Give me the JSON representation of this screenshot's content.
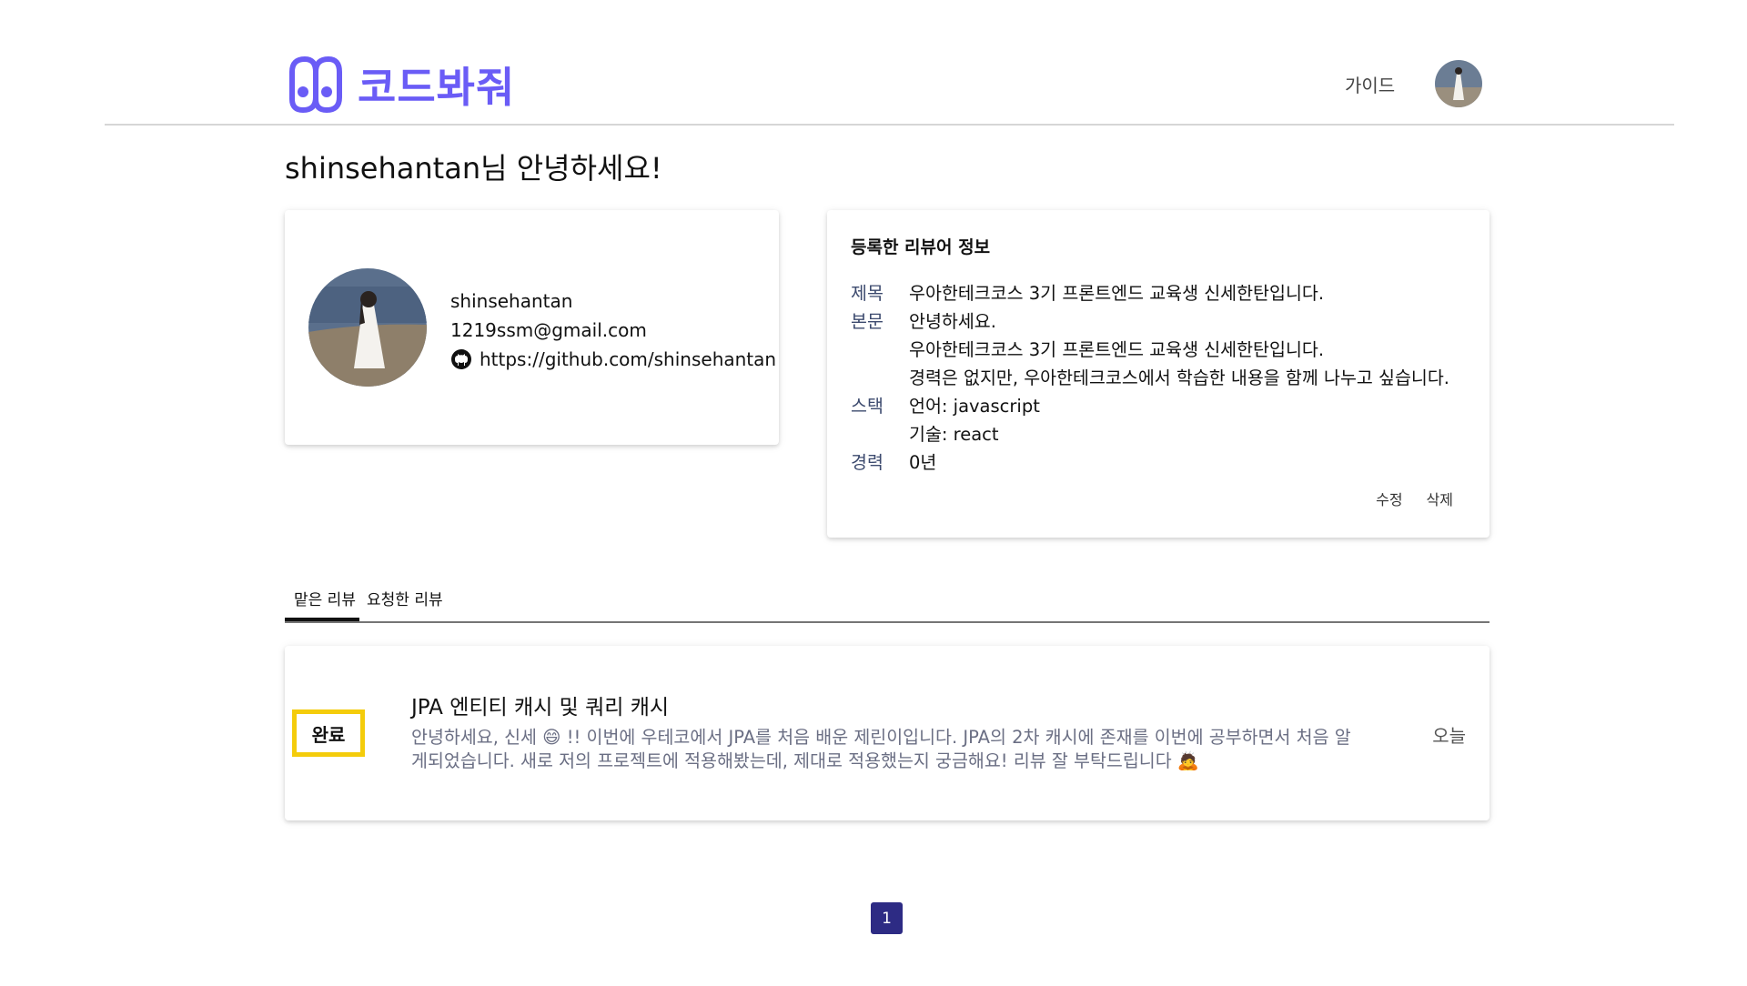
{
  "header": {
    "logo_text": "코드봐줘",
    "nav_guide": "가이드"
  },
  "greeting": "shinsehantan님 안녕하세요!",
  "profile": {
    "username": "shinsehantan",
    "email": "1219ssm@gmail.com",
    "github": "https://github.com/shinsehantan"
  },
  "reviewer": {
    "heading": "등록한 리뷰어 정보",
    "title_label": "제목",
    "title_value": "우아한테크코스 3기 프론트엔드 교육생 신세한탄입니다.",
    "body_label": "본문",
    "body_lines": [
      "안녕하세요.",
      "우아한테크코스 3기 프론트엔드 교육생 신세한탄입니다.",
      "경력은 없지만, 우아한테크코스에서 학습한 내용을 함께 나누고 싶습니다."
    ],
    "stack_label": "스택",
    "stack_lines": [
      "언어: javascript",
      "기술: react"
    ],
    "career_label": "경력",
    "career_value": "0년",
    "edit_label": "수정",
    "delete_label": "삭제"
  },
  "tabs": {
    "received": "맡은 리뷰",
    "requested": "요청한 리뷰"
  },
  "review": {
    "status": "완료",
    "title": "JPA 엔티티 캐시 및 쿼리 캐시",
    "description": "안녕하세요, 신세 😄 !! 이번에 우테코에서 JPA를 처음 배운 제린이입니다. JPA의 2차 캐시에 존재를 이번에 공부하면서 처음 알게되었습니다. 새로 저의 프로젝트에 적용해봤는데, 제대로 적용했는지 궁금해요! 리뷰 잘 부탁드립니다 🙇",
    "date": "오늘"
  },
  "pagination": {
    "current_page": "1"
  },
  "colors": {
    "brand": "#6a5cf6",
    "badge_border": "#f4cc0b",
    "pager_bg": "#2d2b84"
  }
}
